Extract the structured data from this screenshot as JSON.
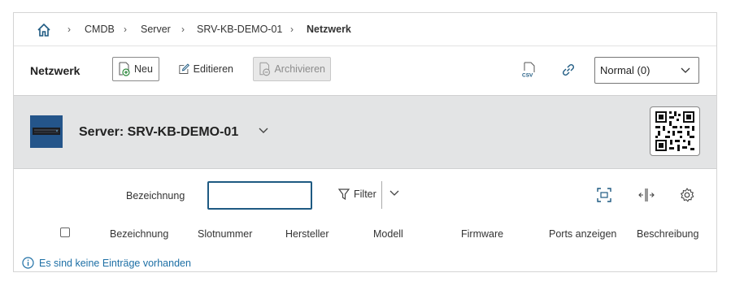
{
  "breadcrumb": {
    "items": [
      "CMDB",
      "Server",
      "SRV-KB-DEMO-01",
      "Netzwerk"
    ]
  },
  "toolbar": {
    "title": "Netzwerk",
    "new_label": "Neu",
    "edit_label": "Editieren",
    "archive_label": "Archivieren",
    "view_select_value": "Normal (0)"
  },
  "object": {
    "title": "Server: SRV-KB-DEMO-01"
  },
  "filter": {
    "field_label": "Bezeichnung",
    "input_value": "",
    "filter_label": "Filter"
  },
  "table": {
    "columns": [
      "Bezeichnung",
      "Slotnummer",
      "Hersteller",
      "Modell",
      "Firmware",
      "Ports anzeigen",
      "Beschreibung"
    ]
  },
  "empty_message": "Es sind keine Einträge vorhanden",
  "colors": {
    "accent": "#1e5a82",
    "banner_bg": "#e3e4e5",
    "info_text": "#1d6fa5"
  },
  "icons": [
    "home-icon",
    "chevron-right-icon",
    "plus-circle-icon",
    "edit-icon",
    "archive-icon",
    "csv-export-icon",
    "link-icon",
    "chevron-down-icon",
    "qr-code-icon",
    "funnel-icon",
    "fullscreen-icon",
    "column-width-icon",
    "gear-icon",
    "info-icon"
  ]
}
